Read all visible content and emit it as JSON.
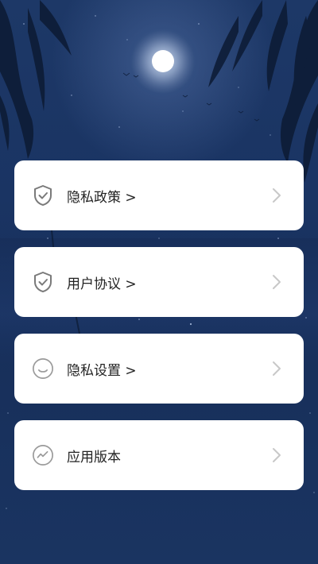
{
  "menu": {
    "items": [
      {
        "label": "隐私政策 >",
        "icon": "shield-check-icon"
      },
      {
        "label": "用户协议 >",
        "icon": "shield-check-icon"
      },
      {
        "label": "隐私设置 >",
        "icon": "smile-circle-icon"
      },
      {
        "label": "应用版本",
        "icon": "trend-circle-icon"
      }
    ],
    "chevron_icon": "chevron-right-icon"
  },
  "colors": {
    "background": "#1a3463",
    "card": "#ffffff",
    "text": "#222222",
    "icon": "#7a7a7a",
    "chevron": "#c8c8c8"
  }
}
